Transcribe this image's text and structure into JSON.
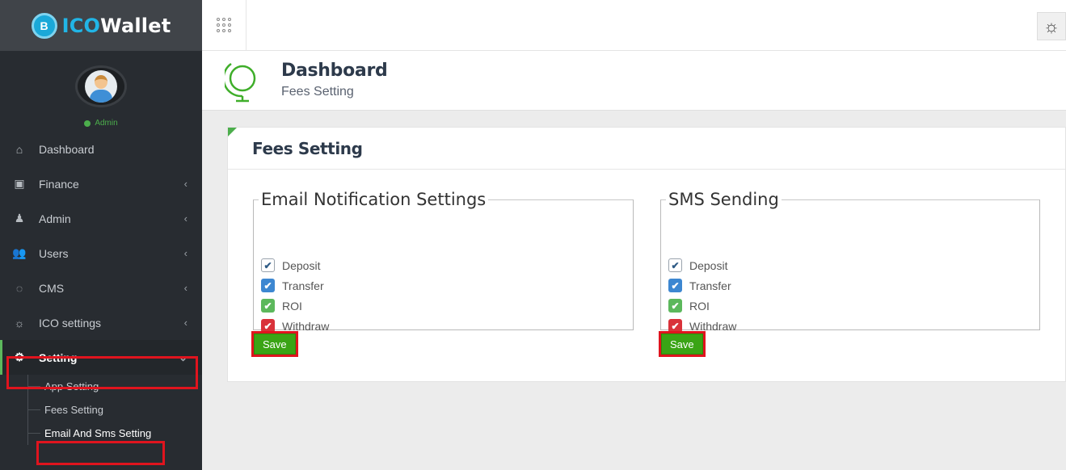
{
  "brand": {
    "prefix": "ICO",
    "suffix": "Wallet",
    "logo_letter": "B"
  },
  "profile": {
    "status": "Admin"
  },
  "sidebar": {
    "items": [
      {
        "label": "Dashboard",
        "icon": "home-icon",
        "glyph": "⌂",
        "arrow": ""
      },
      {
        "label": "Finance",
        "icon": "money-icon",
        "glyph": "▣",
        "arrow": "‹"
      },
      {
        "label": "Admin",
        "icon": "user-secret-icon",
        "glyph": "♟",
        "arrow": "‹"
      },
      {
        "label": "Users",
        "icon": "users-icon",
        "glyph": "👥",
        "arrow": "‹"
      },
      {
        "label": "CMS",
        "icon": "comments-icon",
        "glyph": "◌",
        "arrow": "‹"
      },
      {
        "label": "ICO settings",
        "icon": "sun-icon",
        "glyph": "☼",
        "arrow": "‹"
      },
      {
        "label": "Setting",
        "icon": "gear-icon",
        "glyph": "⚙",
        "arrow": "⌄"
      }
    ],
    "submenu": [
      {
        "label": "App Setting"
      },
      {
        "label": "Fees Setting"
      },
      {
        "label": "Email And Sms Setting"
      }
    ]
  },
  "header": {
    "title": "Dashboard",
    "subtitle": "Fees Setting"
  },
  "card": {
    "title": "Fees Setting"
  },
  "email_settings": {
    "legend": "Email Notification Settings",
    "options": [
      {
        "label": "Deposit",
        "checked": true,
        "color": "white"
      },
      {
        "label": "Transfer",
        "checked": true,
        "color": "blue"
      },
      {
        "label": "ROI",
        "checked": true,
        "color": "green"
      },
      {
        "label": "Withdraw",
        "checked": true,
        "color": "red"
      }
    ],
    "save_label": "Save"
  },
  "sms_settings": {
    "legend": "SMS Sending",
    "options": [
      {
        "label": "Deposit",
        "checked": true,
        "color": "white"
      },
      {
        "label": "Transfer",
        "checked": true,
        "color": "blue"
      },
      {
        "label": "ROI",
        "checked": true,
        "color": "green"
      },
      {
        "label": "Withdraw",
        "checked": true,
        "color": "red"
      }
    ],
    "save_label": "Save"
  },
  "colors": {
    "sidebar_bg": "#282c31",
    "brand_accent": "#21b5e6",
    "save_button": "#3aa415",
    "highlight": "#e0141e",
    "active_indicator": "#5cb85c"
  }
}
